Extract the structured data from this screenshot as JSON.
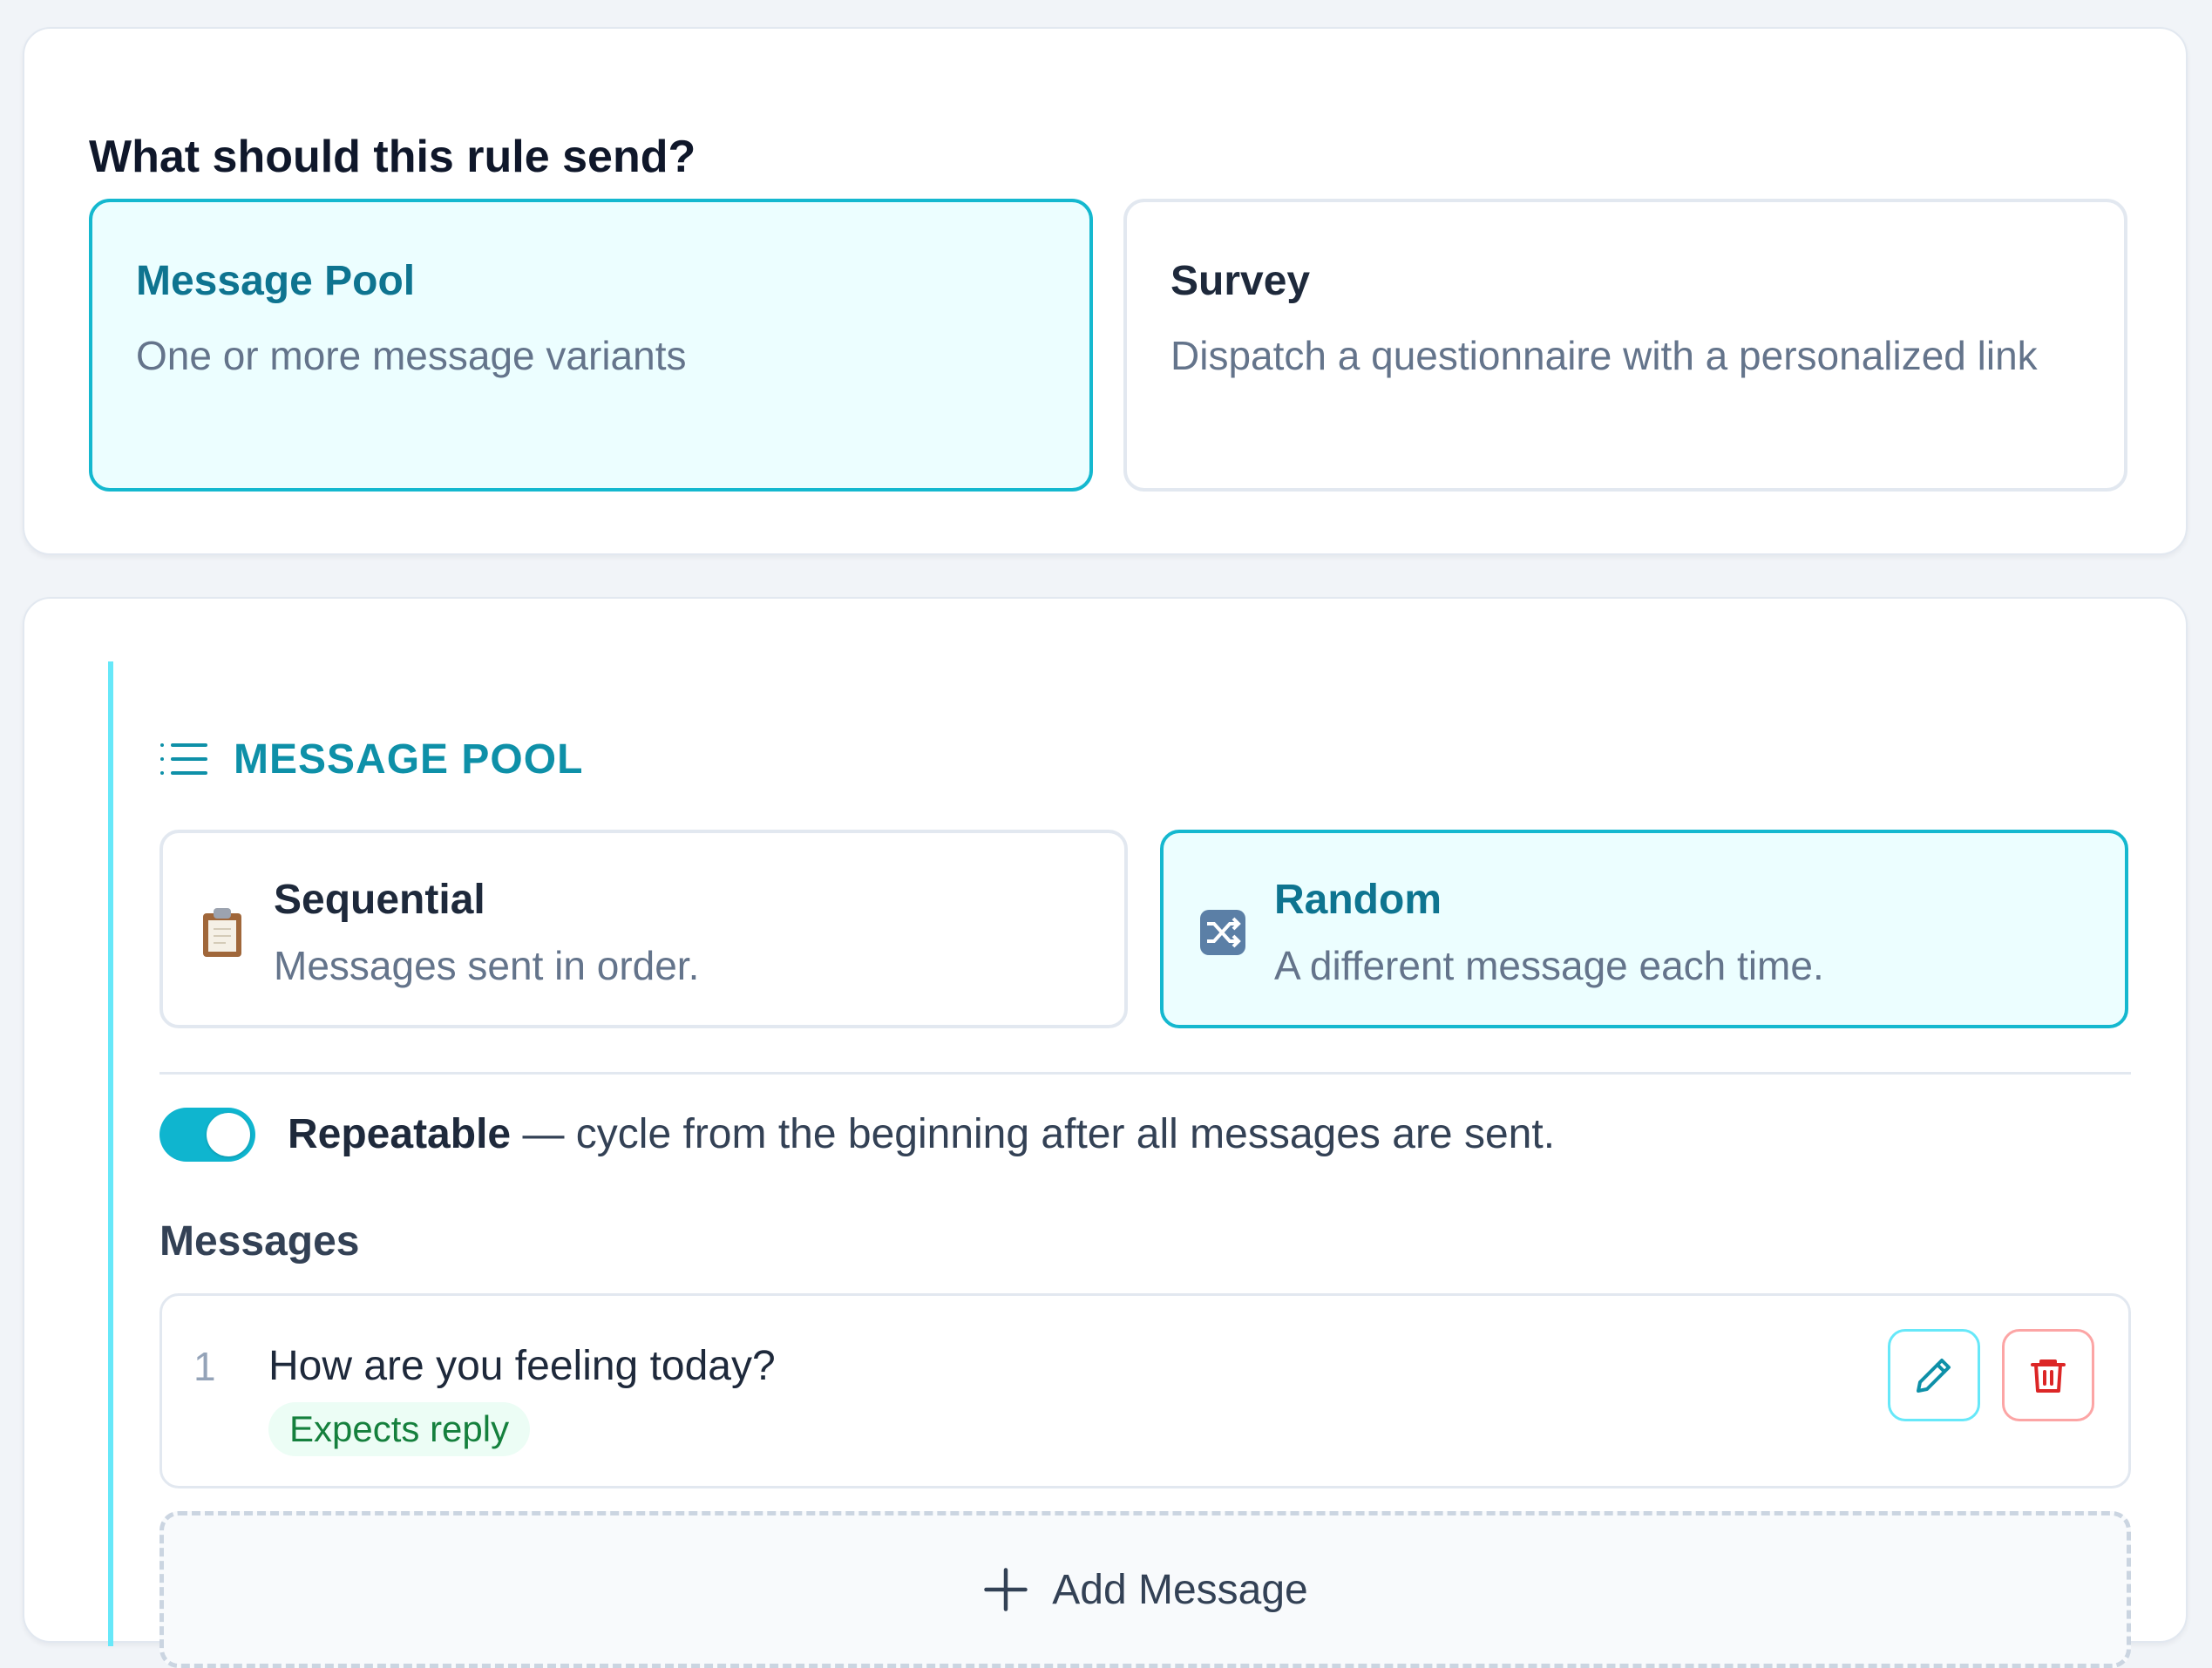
{
  "send_type": {
    "title": "What should this rule send?",
    "options": [
      {
        "title": "Message Pool",
        "description": "One or more message variants",
        "selected": true
      },
      {
        "title": "Survey",
        "description": "Dispatch a questionnaire with a personalized link",
        "selected": false
      }
    ]
  },
  "pool": {
    "header_icon": "list-icon",
    "header": "MESSAGE POOL",
    "modes": [
      {
        "icon": "clipboard-icon",
        "title": "Sequential",
        "description": "Messages sent in order.",
        "selected": false
      },
      {
        "icon": "shuffle-icon",
        "title": "Random",
        "description": "A different message each time.",
        "selected": true
      }
    ],
    "repeatable": {
      "enabled": true,
      "label": "Repeatable",
      "description": " — cycle from the beginning after all messages are sent."
    },
    "messages_label": "Messages",
    "messages": [
      {
        "number": "1",
        "text": "How are you feeling today?",
        "badge": "Expects reply"
      }
    ],
    "add_label": "Add Message"
  },
  "colors": {
    "accent": "#14b8cf",
    "accent_text": "#0e7490",
    "selected_bg": "#ecfeff",
    "danger": "#dc2626",
    "success_text": "#15803d"
  }
}
